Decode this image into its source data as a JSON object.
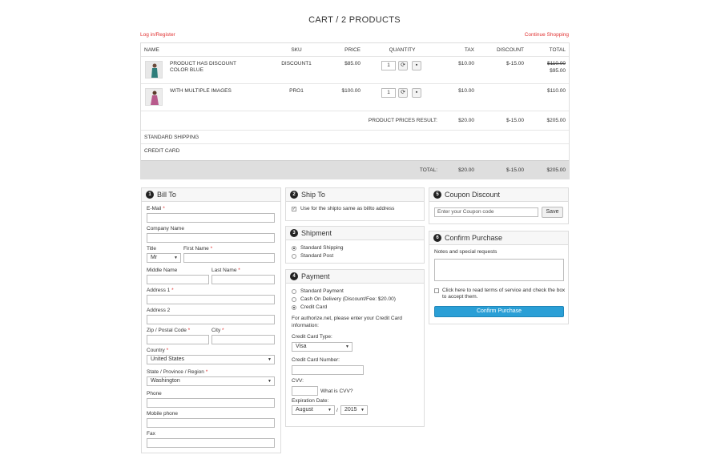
{
  "page": {
    "title": "CART / 2 PRODUCTS",
    "login_link": "Log in/Register",
    "continue_link": "Continue Shopping"
  },
  "cart": {
    "headers": [
      "NAME",
      "SKU",
      "PRICE",
      "QUANTITY",
      "TAX",
      "DISCOUNT",
      "TOTAL"
    ],
    "items": [
      {
        "name_line1": "PRODUCT HAS DISCOUNT",
        "name_line2": "COLOR BLUE",
        "sku": "DISCOUNT1",
        "price": "$85.00",
        "qty": "1",
        "tax": "$10.00",
        "discount": "$-15.00",
        "total_old": "$110.00",
        "total": "$95.00"
      },
      {
        "name_line1": "WITH MULTIPLE IMAGES",
        "name_line2": "",
        "sku": "PRO1",
        "price": "$100.00",
        "qty": "1",
        "tax": "$10.00",
        "discount": "",
        "total_old": "",
        "total": "$110.00"
      }
    ],
    "result": {
      "label": "PRODUCT PRICES RESULT:",
      "tax": "$20.00",
      "discount": "$-15.00",
      "total": "$205.00"
    },
    "shipping_label": "STANDARD SHIPPING",
    "payment_label": "CREDIT CARD",
    "grand": {
      "label": "TOTAL:",
      "tax": "$20.00",
      "discount": "$-15.00",
      "total": "$205.00"
    }
  },
  "bill": {
    "number": "1",
    "title": "Bill To",
    "email_label": "E-Mail",
    "company_label": "Company Name",
    "title_label": "Title",
    "title_value": "Mr",
    "first_name_label": "First Name",
    "middle_name_label": "Middle Name",
    "last_name_label": "Last Name",
    "address1_label": "Address 1",
    "address2_label": "Address 2",
    "zip_label": "Zip / Postal Code",
    "city_label": "City",
    "country_label": "Country",
    "country_value": "United States",
    "state_label": "State / Province / Region",
    "state_value": "Washington",
    "phone_label": "Phone",
    "mobile_label": "Mobile phone",
    "fax_label": "Fax",
    "required_mark": "*"
  },
  "ship": {
    "number": "2",
    "title": "Ship To",
    "same_label": "Use for the shipto same as billto address"
  },
  "shipment": {
    "number": "3",
    "title": "Shipment",
    "options": [
      "Standard Shipping",
      "Standard Post"
    ]
  },
  "payment": {
    "number": "4",
    "title": "Payment",
    "options": [
      "Standard Payment",
      "Cash On Delivery (Discount/Fee: $20.00)",
      "Credit Card"
    ],
    "info_line1": "For authorize.net, please enter your Credit Card",
    "info_line2": "information:",
    "card_type_label": "Credit Card Type:",
    "card_type_value": "Visa",
    "card_number_label": "Credit Card Number:",
    "cvv_label": "CVV:",
    "cvv_help": "What is CVV?",
    "expiration_label": "Expiration Date:",
    "month_value": "August",
    "separator": "/",
    "year_value": "2015"
  },
  "coupon": {
    "number": "5",
    "title": "Coupon Discount",
    "placeholder": "Enter your Coupon code",
    "save_label": "Save"
  },
  "confirm": {
    "number": "6",
    "title": "Confirm Purchase",
    "notes_label": "Notes and special requests",
    "terms_line1": "Click here to read terms of service and check the box",
    "terms_line2": "to accept them.",
    "button_label": "Confirm Purchase"
  }
}
